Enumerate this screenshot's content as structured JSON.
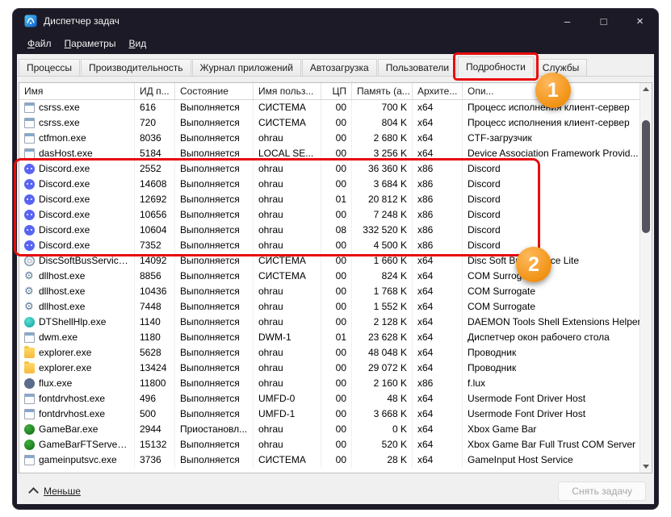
{
  "window": {
    "title": "Диспетчер задач",
    "controls": {
      "minimize_icon": "–",
      "maximize_icon": "□",
      "close_icon": "×"
    }
  },
  "menu": {
    "items": [
      {
        "label": "Файл"
      },
      {
        "label": "Параметры"
      },
      {
        "label": "Вид"
      }
    ]
  },
  "tabs": [
    {
      "label": "Процессы",
      "selected": false
    },
    {
      "label": "Производительность",
      "selected": false
    },
    {
      "label": "Журнал приложений",
      "selected": false
    },
    {
      "label": "Автозагрузка",
      "selected": false
    },
    {
      "label": "Пользователи",
      "selected": false
    },
    {
      "label": "Подробности",
      "selected": true
    },
    {
      "label": "Службы",
      "selected": false
    }
  ],
  "table": {
    "columns": [
      {
        "key": "name",
        "label": "Имя"
      },
      {
        "key": "pid",
        "label": "ИД п..."
      },
      {
        "key": "status",
        "label": "Состояние"
      },
      {
        "key": "user",
        "label": "Имя польз..."
      },
      {
        "key": "cpu",
        "label": "ЦП"
      },
      {
        "key": "mem",
        "label": "Память (а..."
      },
      {
        "key": "arch",
        "label": "Архите..."
      },
      {
        "key": "desc",
        "label": "Опи..."
      }
    ],
    "rows": [
      {
        "icon": "generic-app-icon",
        "name": "csrss.exe",
        "pid": "616",
        "status": "Выполняется",
        "user": "СИСТЕМА",
        "cpu": "00",
        "mem": "700 K",
        "arch": "x64",
        "desc": "Процесс исполнения клиент-сервер",
        "highlight": false
      },
      {
        "icon": "generic-app-icon",
        "name": "csrss.exe",
        "pid": "720",
        "status": "Выполняется",
        "user": "СИСТЕМА",
        "cpu": "00",
        "mem": "804 K",
        "arch": "x64",
        "desc": "Процесс исполнения клиент-сервер",
        "highlight": false
      },
      {
        "icon": "generic-app-icon",
        "name": "ctfmon.exe",
        "pid": "8036",
        "status": "Выполняется",
        "user": "ohrau",
        "cpu": "00",
        "mem": "2 680 K",
        "arch": "x64",
        "desc": "CTF-загрузчик",
        "highlight": false
      },
      {
        "icon": "generic-app-icon",
        "name": "dasHost.exe",
        "pid": "5184",
        "status": "Выполняется",
        "user": "LOCAL SE...",
        "cpu": "00",
        "mem": "3 256 K",
        "arch": "x64",
        "desc": "Device Association Framework Provid...",
        "highlight": false
      },
      {
        "icon": "discord-icon",
        "name": "Discord.exe",
        "pid": "2552",
        "status": "Выполняется",
        "user": "ohrau",
        "cpu": "00",
        "mem": "36 360 K",
        "arch": "x86",
        "desc": "Discord",
        "highlight": true
      },
      {
        "icon": "discord-icon",
        "name": "Discord.exe",
        "pid": "14608",
        "status": "Выполняется",
        "user": "ohrau",
        "cpu": "00",
        "mem": "3 684 K",
        "arch": "x86",
        "desc": "Discord",
        "highlight": true
      },
      {
        "icon": "discord-icon",
        "name": "Discord.exe",
        "pid": "12692",
        "status": "Выполняется",
        "user": "ohrau",
        "cpu": "01",
        "mem": "20 812 K",
        "arch": "x86",
        "desc": "Discord",
        "highlight": true
      },
      {
        "icon": "discord-icon",
        "name": "Discord.exe",
        "pid": "10656",
        "status": "Выполняется",
        "user": "ohrau",
        "cpu": "00",
        "mem": "7 248 K",
        "arch": "x86",
        "desc": "Discord",
        "highlight": true
      },
      {
        "icon": "discord-icon",
        "name": "Discord.exe",
        "pid": "10604",
        "status": "Выполняется",
        "user": "ohrau",
        "cpu": "08",
        "mem": "332 520 K",
        "arch": "x86",
        "desc": "Discord",
        "highlight": true
      },
      {
        "icon": "discord-icon",
        "name": "Discord.exe",
        "pid": "7352",
        "status": "Выполняется",
        "user": "ohrau",
        "cpu": "00",
        "mem": "4 500 K",
        "arch": "x86",
        "desc": "Discord",
        "highlight": true
      },
      {
        "icon": "disc-icon",
        "name": "DiscSoftBusServiceLi...",
        "pid": "14092",
        "status": "Выполняется",
        "user": "СИСТЕМА",
        "cpu": "00",
        "mem": "1 660 K",
        "arch": "x64",
        "desc": "Disc Soft Bus Service Lite",
        "highlight": false
      },
      {
        "icon": "gear-icon",
        "name": "dllhost.exe",
        "pid": "8856",
        "status": "Выполняется",
        "user": "СИСТЕМА",
        "cpu": "00",
        "mem": "824 K",
        "arch": "x64",
        "desc": "COM Surrogate",
        "highlight": false
      },
      {
        "icon": "gear-icon",
        "name": "dllhost.exe",
        "pid": "10436",
        "status": "Выполняется",
        "user": "ohrau",
        "cpu": "00",
        "mem": "1 768 K",
        "arch": "x64",
        "desc": "COM Surrogate",
        "highlight": false
      },
      {
        "icon": "gear-icon",
        "name": "dllhost.exe",
        "pid": "7448",
        "status": "Выполняется",
        "user": "ohrau",
        "cpu": "00",
        "mem": "1 552 K",
        "arch": "x64",
        "desc": "COM Surrogate",
        "highlight": false
      },
      {
        "icon": "daemon-tools-icon",
        "name": "DTShellHlp.exe",
        "pid": "1140",
        "status": "Выполняется",
        "user": "ohrau",
        "cpu": "00",
        "mem": "2 128 K",
        "arch": "x64",
        "desc": "DAEMON Tools Shell Extensions Helper",
        "highlight": false
      },
      {
        "icon": "generic-app-icon",
        "name": "dwm.exe",
        "pid": "1180",
        "status": "Выполняется",
        "user": "DWM-1",
        "cpu": "01",
        "mem": "23 628 K",
        "arch": "x64",
        "desc": "Диспетчер окон рабочего стола",
        "highlight": false
      },
      {
        "icon": "folder-icon",
        "name": "explorer.exe",
        "pid": "5628",
        "status": "Выполняется",
        "user": "ohrau",
        "cpu": "00",
        "mem": "48 048 K",
        "arch": "x64",
        "desc": "Проводник",
        "highlight": false
      },
      {
        "icon": "folder-icon",
        "name": "explorer.exe",
        "pid": "13424",
        "status": "Выполняется",
        "user": "ohrau",
        "cpu": "00",
        "mem": "29 072 K",
        "arch": "x64",
        "desc": "Проводник",
        "highlight": false
      },
      {
        "icon": "flux-icon",
        "name": "flux.exe",
        "pid": "11800",
        "status": "Выполняется",
        "user": "ohrau",
        "cpu": "00",
        "mem": "2 160 K",
        "arch": "x86",
        "desc": "f.lux",
        "highlight": false
      },
      {
        "icon": "generic-app-icon",
        "name": "fontdrvhost.exe",
        "pid": "496",
        "status": "Выполняется",
        "user": "UMFD-0",
        "cpu": "00",
        "mem": "48 K",
        "arch": "x64",
        "desc": "Usermode Font Driver Host",
        "highlight": false
      },
      {
        "icon": "generic-app-icon",
        "name": "fontdrvhost.exe",
        "pid": "500",
        "status": "Выполняется",
        "user": "UMFD-1",
        "cpu": "00",
        "mem": "3 668 K",
        "arch": "x64",
        "desc": "Usermode Font Driver Host",
        "highlight": false
      },
      {
        "icon": "xbox-icon",
        "name": "GameBar.exe",
        "pid": "2944",
        "status": "Приостановл...",
        "user": "ohrau",
        "cpu": "00",
        "mem": "0 K",
        "arch": "x64",
        "desc": "Xbox Game Bar",
        "highlight": false
      },
      {
        "icon": "xbox-icon",
        "name": "GameBarFTServer.exe",
        "pid": "15132",
        "status": "Выполняется",
        "user": "ohrau",
        "cpu": "00",
        "mem": "520 K",
        "arch": "x64",
        "desc": "Xbox Game Bar Full Trust COM Server",
        "highlight": false
      },
      {
        "icon": "generic-app-icon",
        "name": "gameinputsvc.exe",
        "pid": "3736",
        "status": "Выполняется",
        "user": "СИСТЕМА",
        "cpu": "00",
        "mem": "28 K",
        "arch": "x64",
        "desc": "GameInput Host Service",
        "highlight": false
      }
    ]
  },
  "footer": {
    "less_label": "Меньше",
    "end_task_label": "Снять задачу"
  },
  "annotations": {
    "step1_label": "1",
    "step2_label": "2",
    "highlight_color": "#e80c0c",
    "badge_color": "#f19315"
  }
}
